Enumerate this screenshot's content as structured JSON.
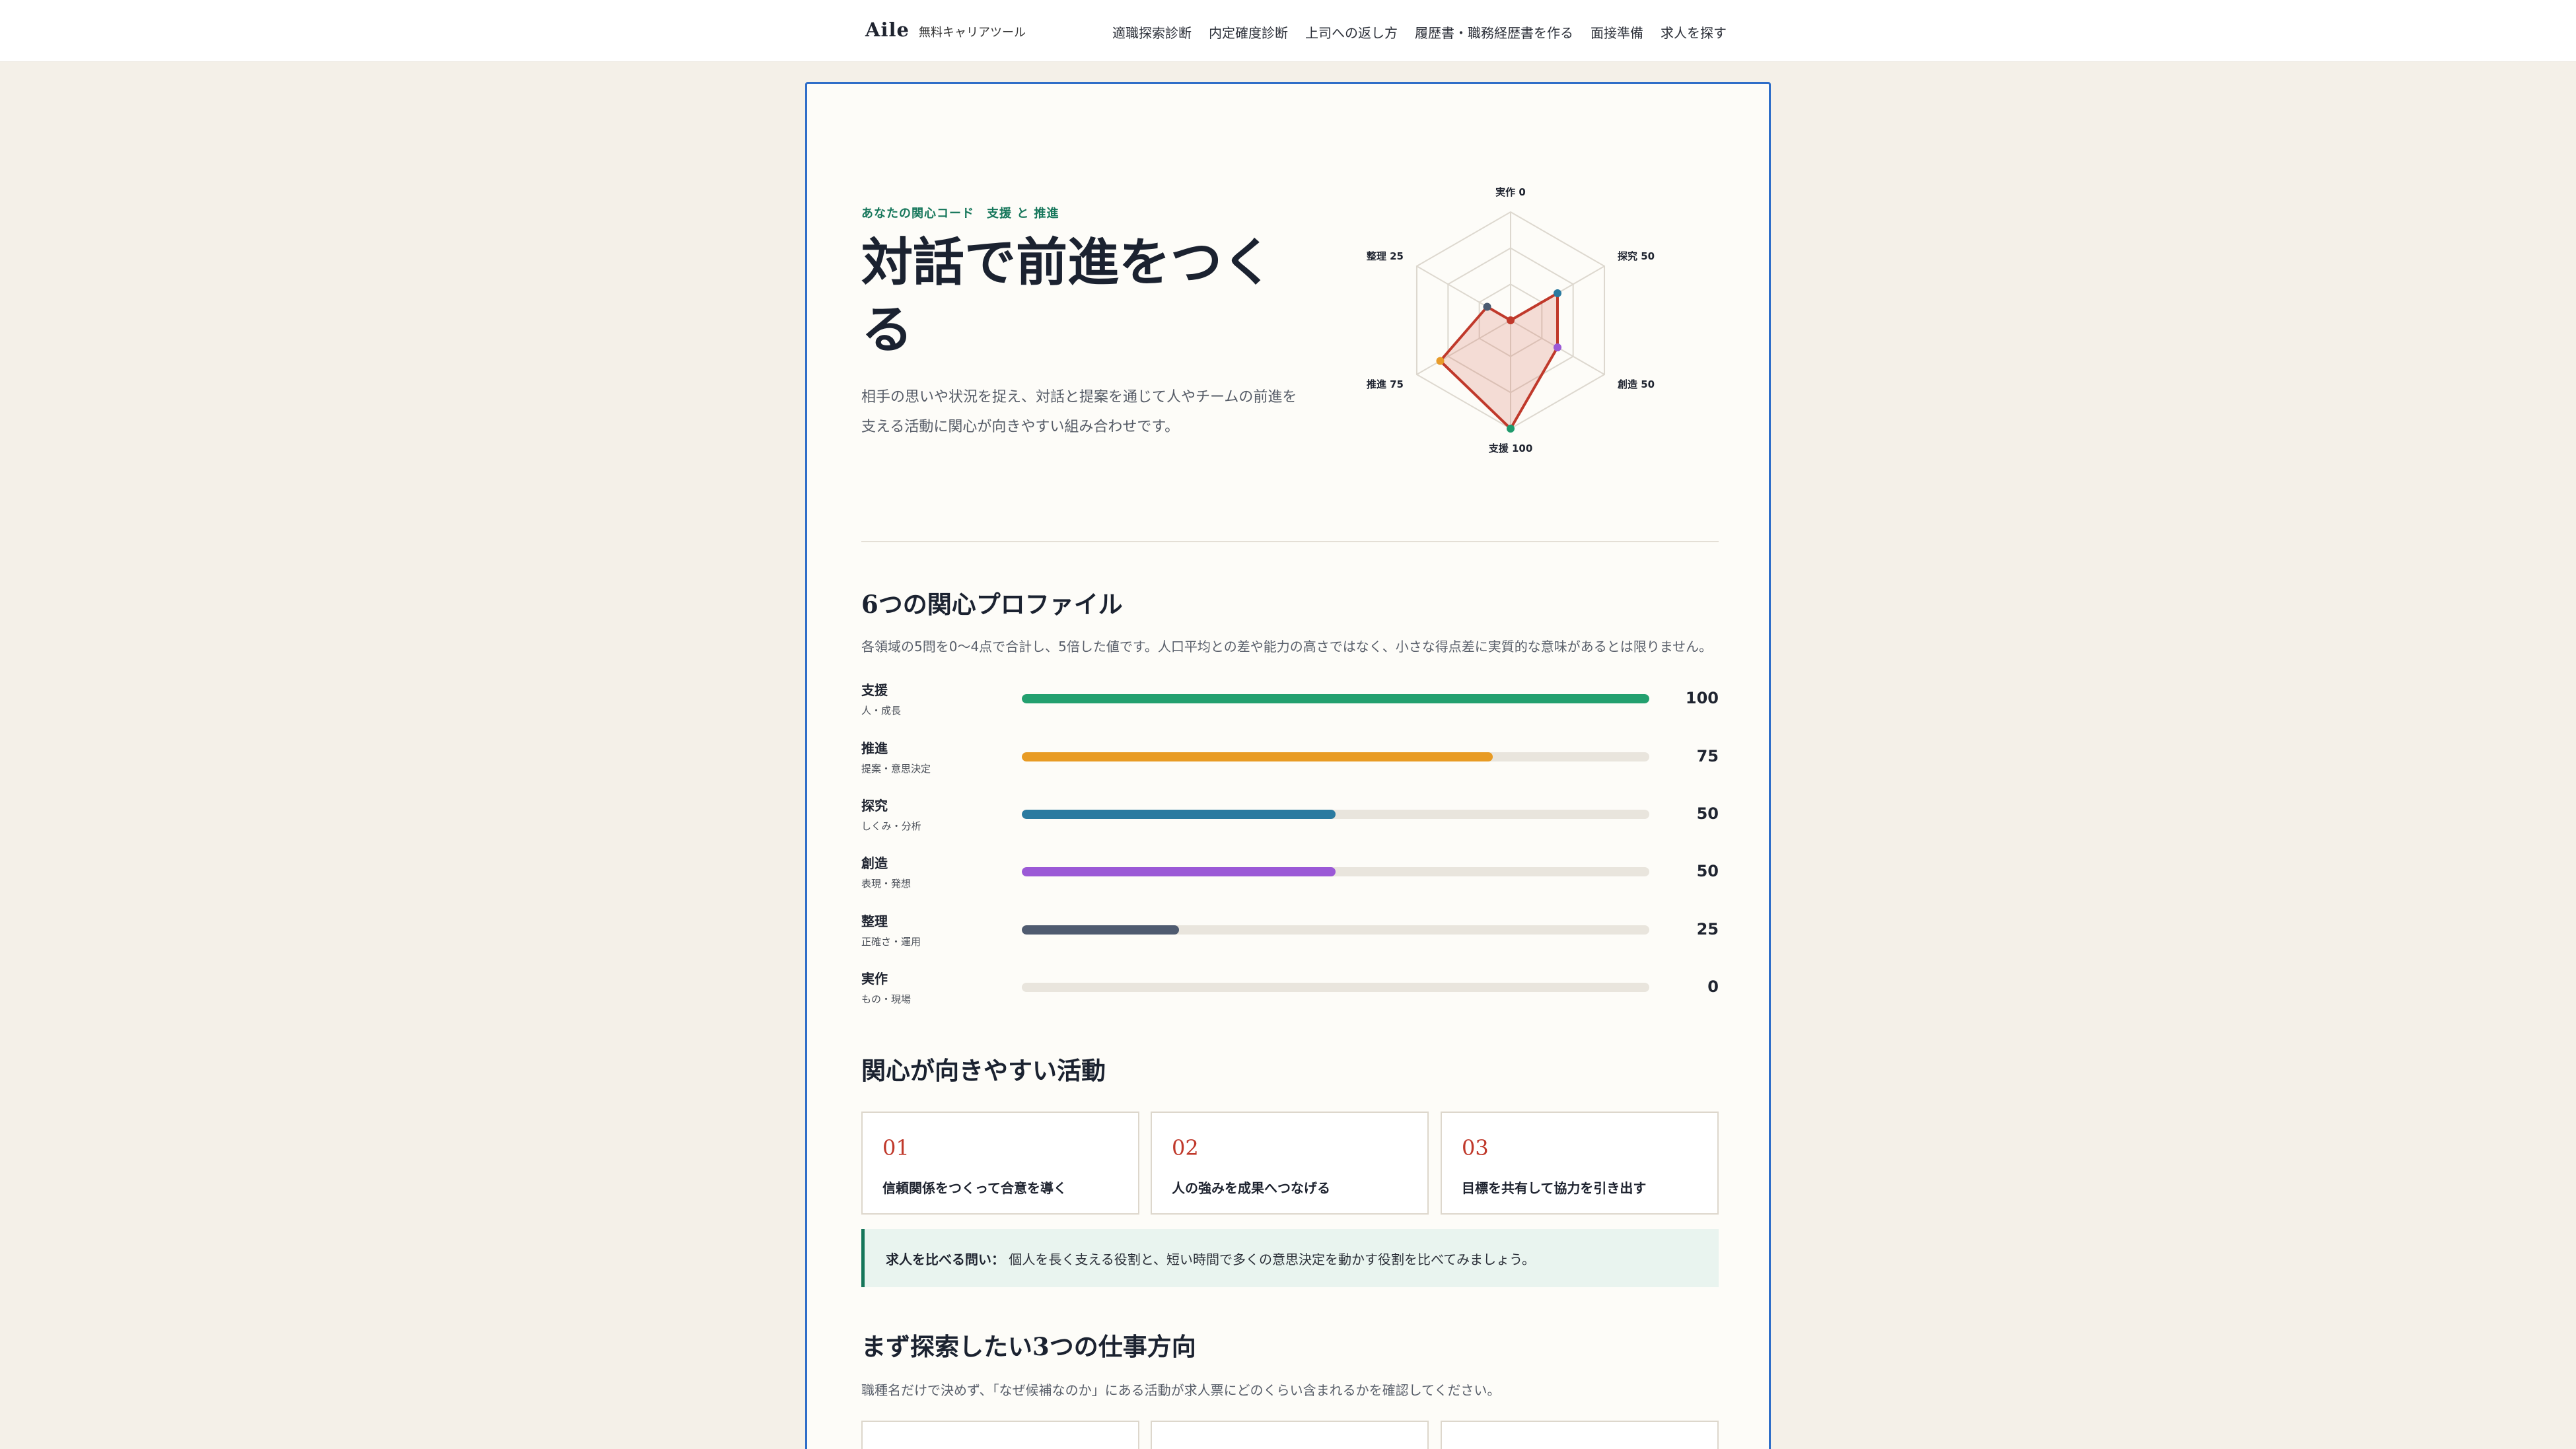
{
  "header": {
    "logo": "Aile",
    "subtitle": "無料キャリアツール",
    "nav": [
      "適職探索診断",
      "内定確度診断",
      "上司への返し方",
      "履歴書・職務経歴書を作る",
      "面接準備",
      "求人を探す"
    ]
  },
  "result": {
    "kicker": "あなたの関心コード　支援 と 推進",
    "title": "対話で前進をつくる",
    "description": "相手の思いや状況を捉え、対話と提案を通じて人やチームの前進を支える活動に関心が向きやすい組み合わせです。"
  },
  "radar": {
    "labels": [
      "実作 0",
      "探究 50",
      "創造 50",
      "支援 100",
      "推進 75",
      "整理 25"
    ],
    "values": [
      0,
      50,
      50,
      100,
      75,
      25
    ],
    "max": 100,
    "point_colors": [
      "#c0392b",
      "#2a7aa0",
      "#9b59d6",
      "#1f9a6c",
      "#e89b2a",
      "#4a5a70"
    ],
    "line_color": "#c0392b"
  },
  "profile": {
    "title": "6つの関心プロファイル",
    "note": "各領域の5問を0〜4点で合計し、5倍した値です。人口平均との差や能力の高さではなく、小さな得点差に実質的な意味があるとは限りません。",
    "items": [
      {
        "name": "支援",
        "sub": "人・成長",
        "value": 100,
        "display": "100",
        "color": "#23a06f"
      },
      {
        "name": "推進",
        "sub": "提案・意思決定",
        "value": 75,
        "display": "75",
        "color": "#e89b24"
      },
      {
        "name": "探究",
        "sub": "しくみ・分析",
        "value": 50,
        "display": "50",
        "color": "#2a7aa0"
      },
      {
        "name": "創造",
        "sub": "表現・発想",
        "value": 50,
        "display": "50",
        "color": "#9b59d6"
      },
      {
        "name": "整理",
        "sub": "正確さ・運用",
        "value": 25,
        "display": "25",
        "color": "#4f5b70"
      },
      {
        "name": "実作",
        "sub": "もの・現場",
        "value": 0,
        "display": "0",
        "color": "#c9c2b6"
      }
    ]
  },
  "activities": {
    "title": "関心が向きやすい活動",
    "items": [
      {
        "num": "01",
        "text": "信頼関係をつくって合意を導く"
      },
      {
        "num": "02",
        "text": "人の強みを成果へつなげる"
      },
      {
        "num": "03",
        "text": "目標を共有して協力を引き出す"
      }
    ],
    "callout_label": "求人を比べる問い：",
    "callout_text": "個人を長く支える役割と、短い時間で多くの意思決定を動かす役割を比べてみましょう。"
  },
  "directions": {
    "title": "まず探索したい3つの仕事方向",
    "note": "職種名だけで決めず、「なぜ候補なのか」にある活動が求人票にどのくらい含まれるかを確認してください。"
  }
}
